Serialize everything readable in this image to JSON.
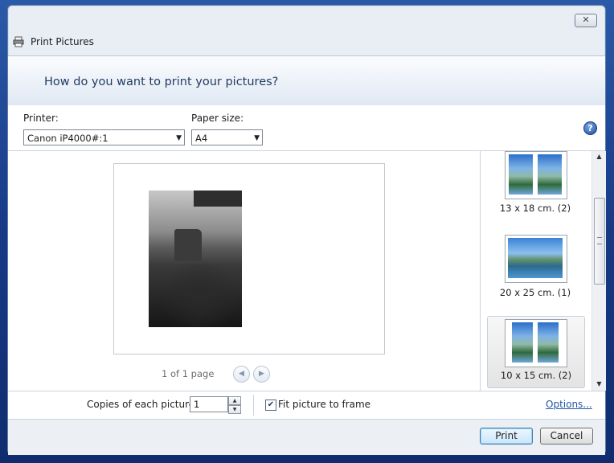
{
  "window": {
    "title": "Print Pictures",
    "close_glyph": "✕",
    "question": "How do you want to print your pictures?"
  },
  "printer": {
    "label": "Printer:",
    "value": "Canon iP4000#:1"
  },
  "paper_size": {
    "label": "Paper size:",
    "value": "A4"
  },
  "help_glyph": "?",
  "preview": {
    "page_text": "1 of 1 page"
  },
  "layouts": [
    {
      "label": "13 x 18 cm. (2)"
    },
    {
      "label": "20 x 25 cm. (1)"
    },
    {
      "label": "10 x 15 cm. (2)"
    }
  ],
  "copies": {
    "label": "Copies of each picture:",
    "value": "1"
  },
  "fit": {
    "label": "Fit picture to frame",
    "checked": true
  },
  "options_link": "Options...",
  "buttons": {
    "print": "Print",
    "cancel": "Cancel"
  },
  "colors": {
    "accent": "#2456a6",
    "banner_text": "#1e3a5f"
  }
}
